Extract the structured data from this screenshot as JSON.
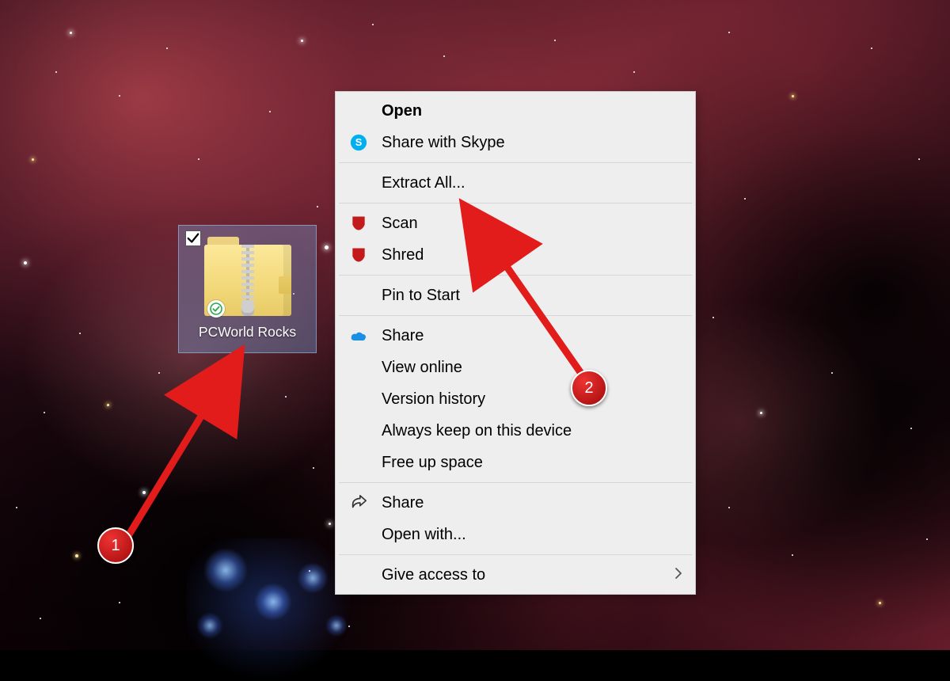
{
  "icon": {
    "filename": "PCWorld Rocks",
    "checked": true
  },
  "menu": {
    "open": "Open",
    "share_skype": "Share with Skype",
    "extract_all": "Extract All...",
    "scan": "Scan",
    "shred": "Shred",
    "pin_to_start": "Pin to Start",
    "share_onedrive": "Share",
    "view_online": "View online",
    "version_history": "Version history",
    "always_keep": "Always keep on this device",
    "free_up_space": "Free up space",
    "share": "Share",
    "open_with": "Open with...",
    "give_access_to": "Give access to"
  },
  "annotations": {
    "badge1": "1",
    "badge2": "2"
  }
}
